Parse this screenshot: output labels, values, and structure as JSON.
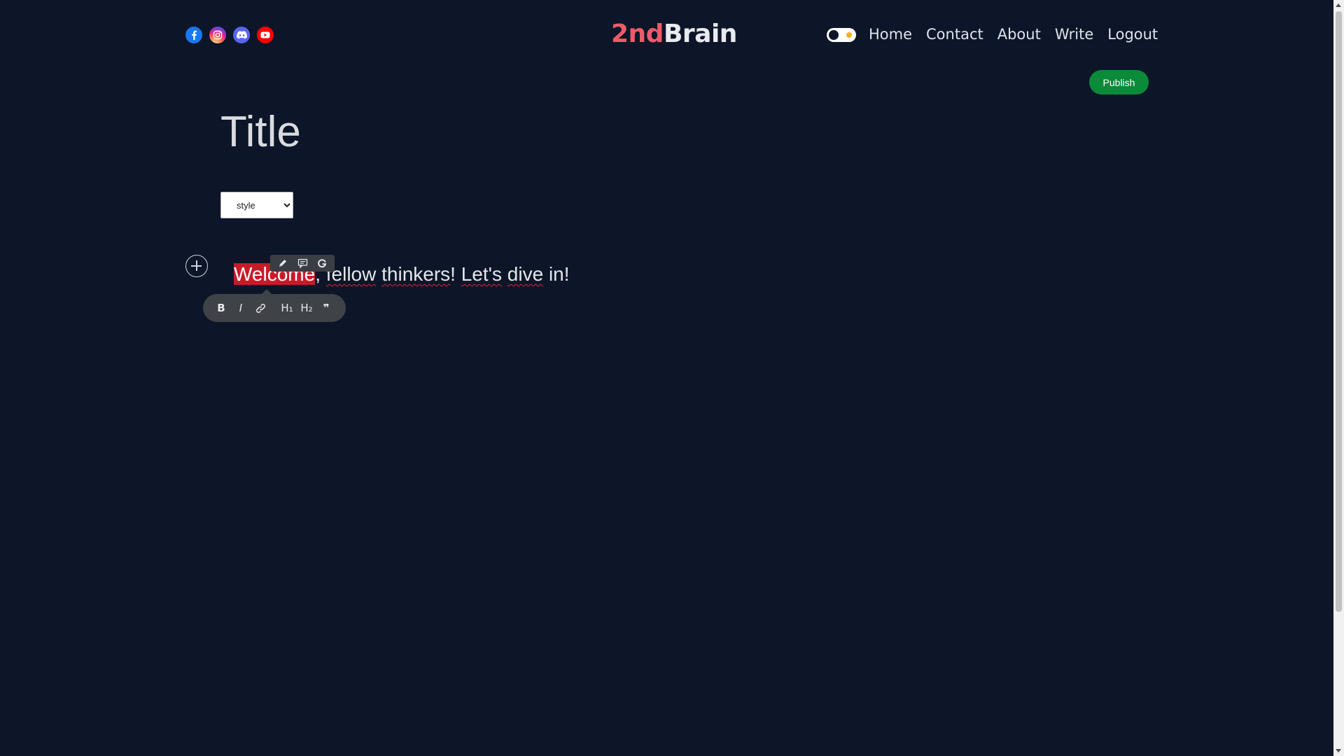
{
  "header": {
    "logo_part1": "2nd",
    "logo_part2": "Brain",
    "social_icons": [
      "facebook-icon",
      "instagram-icon",
      "discord-icon",
      "youtube-icon"
    ],
    "nav": [
      "Home",
      "Contact",
      "About",
      "Write",
      "Logout"
    ],
    "theme_toggle": "dark-mode"
  },
  "editor": {
    "publish_label": "Publish",
    "title_placeholder": "Title",
    "style_select": {
      "selected": "style"
    },
    "body": {
      "highlighted_word": "Welcome",
      "comma": ", ",
      "word_fellow": "fellow",
      "space1": " ",
      "word_thinkers": "thinkers",
      "mid": "! ",
      "word_lets": "Let's",
      "space2": " ",
      "word_dive": "dive",
      "tail": " in!"
    },
    "mini_toolbar": [
      "pencil-icon",
      "comment-icon",
      "grammarly-icon"
    ],
    "format_toolbar": {
      "bold": "B",
      "italic": "I",
      "h1": "H₁",
      "h2": "H₂",
      "quote": "❞"
    }
  },
  "colors": {
    "background": "#0c1628",
    "logo_accent": "#ef5a6a",
    "publish": "#0b8a3a",
    "highlight": "#c81b2a"
  }
}
